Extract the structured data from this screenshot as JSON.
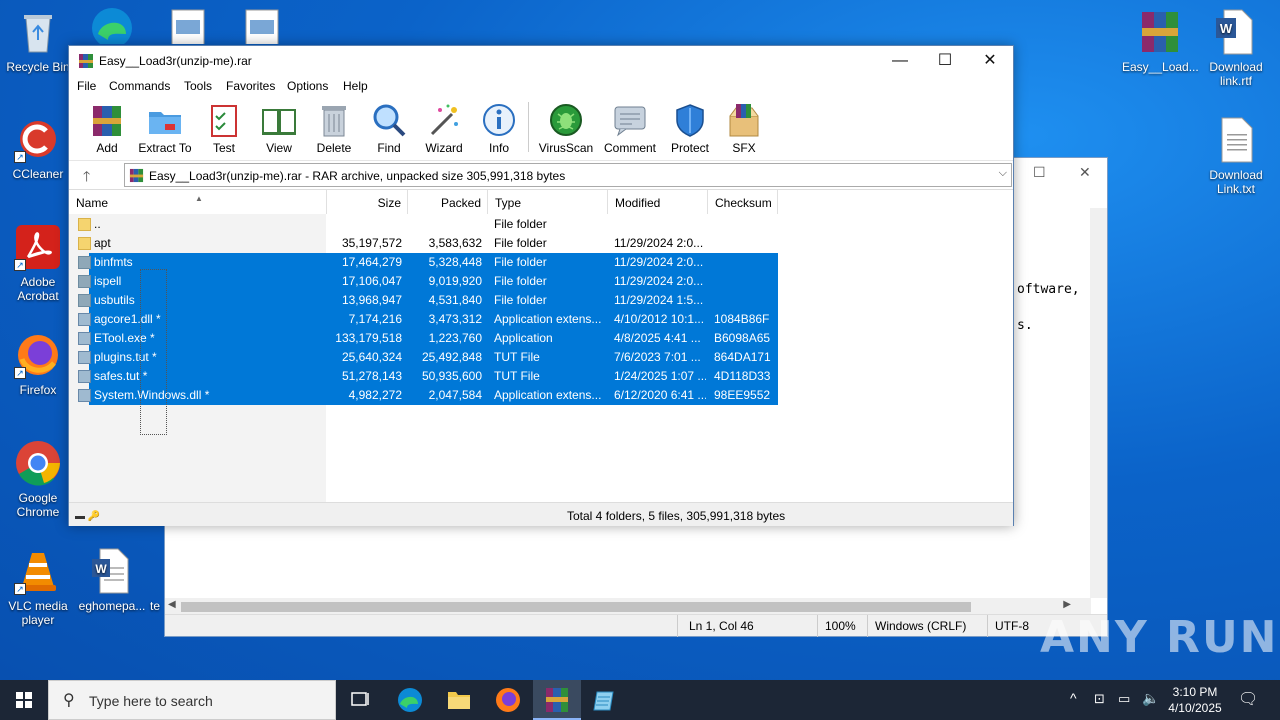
{
  "desktop": {
    "icons_left": [
      {
        "label": "Recycle Bin"
      },
      {
        "label": "CCleaner"
      },
      {
        "label": "Adobe Acrobat"
      },
      {
        "label": "Firefox"
      },
      {
        "label": "Google Chrome"
      },
      {
        "label": "VLC media player"
      },
      {
        "label": "eghomepa..."
      },
      {
        "label": "te"
      }
    ],
    "icons_right": [
      {
        "label": "Easy__Load..."
      },
      {
        "label": "Download link.rtf"
      },
      {
        "label": "Download Link.txt"
      }
    ]
  },
  "notepad": {
    "text_lines": [
      "oftware,",
      "s."
    ],
    "status": {
      "position": "Ln 1, Col 46",
      "zoom": "100%",
      "eol": "Windows (CRLF)",
      "encoding": "UTF-8"
    }
  },
  "winrar": {
    "title": "Easy__Load3r(unzip-me).rar",
    "menu": [
      "File",
      "Commands",
      "Tools",
      "Favorites",
      "Options",
      "Help"
    ],
    "toolbar": [
      "Add",
      "Extract To",
      "Test",
      "View",
      "Delete",
      "Find",
      "Wizard",
      "Info",
      "VirusScan",
      "Comment",
      "Protect",
      "SFX"
    ],
    "address": "Easy__Load3r(unzip-me).rar - RAR archive, unpacked size 305,991,318 bytes",
    "columns": [
      "Name",
      "Size",
      "Packed",
      "Type",
      "Modified",
      "Checksum"
    ],
    "rows": [
      {
        "name": "..",
        "size": "",
        "packed": "",
        "type": "File folder",
        "modified": "",
        "checksum": "",
        "kind": "folder",
        "selected": false
      },
      {
        "name": "apt",
        "size": "35,197,572",
        "packed": "3,583,632",
        "type": "File folder",
        "modified": "11/29/2024 2:0...",
        "checksum": "",
        "kind": "folder",
        "selected": false
      },
      {
        "name": "binfmts",
        "size": "17,464,279",
        "packed": "5,328,448",
        "type": "File folder",
        "modified": "11/29/2024 2:0...",
        "checksum": "",
        "kind": "folder",
        "selected": true
      },
      {
        "name": "ispell",
        "size": "17,106,047",
        "packed": "9,019,920",
        "type": "File folder",
        "modified": "11/29/2024 2:0...",
        "checksum": "",
        "kind": "folder",
        "selected": true
      },
      {
        "name": "usbutils",
        "size": "13,968,947",
        "packed": "4,531,840",
        "type": "File folder",
        "modified": "11/29/2024 1:5...",
        "checksum": "",
        "kind": "folder",
        "selected": true
      },
      {
        "name": "agcore1.dll *",
        "size": "7,174,216",
        "packed": "3,473,312",
        "type": "Application extens...",
        "modified": "4/10/2012 10:1...",
        "checksum": "1084B86F",
        "kind": "file",
        "selected": true
      },
      {
        "name": "ETool.exe *",
        "size": "133,179,518",
        "packed": "1,223,760",
        "type": "Application",
        "modified": "4/8/2025 4:41 ...",
        "checksum": "B6098A65",
        "kind": "file",
        "selected": true
      },
      {
        "name": "plugins.tut *",
        "size": "25,640,324",
        "packed": "25,492,848",
        "type": "TUT File",
        "modified": "7/6/2023 7:01 ...",
        "checksum": "864DA171",
        "kind": "file",
        "selected": true
      },
      {
        "name": "safes.tut *",
        "size": "51,278,143",
        "packed": "50,935,600",
        "type": "TUT File",
        "modified": "1/24/2025 1:07 ...",
        "checksum": "4D118D33",
        "kind": "file",
        "selected": true
      },
      {
        "name": "System.Windows.dll *",
        "size": "4,982,272",
        "packed": "2,047,584",
        "type": "Application extens...",
        "modified": "6/12/2020 6:41 ...",
        "checksum": "98EE9552",
        "kind": "file",
        "selected": true
      }
    ],
    "status": "Total 4 folders, 5 files, 305,991,318 bytes"
  },
  "watermark": "ANY RUN",
  "taskbar": {
    "search_placeholder": "Type here to search",
    "time": "3:10 PM",
    "date": "4/10/2025",
    "apps": [
      "task-view",
      "edge",
      "file-explorer",
      "firefox",
      "winrar",
      "notepad"
    ]
  },
  "colors": {
    "selection": "#0078d7",
    "taskbar": "#1c2636",
    "desktop": "#0b63c9"
  }
}
